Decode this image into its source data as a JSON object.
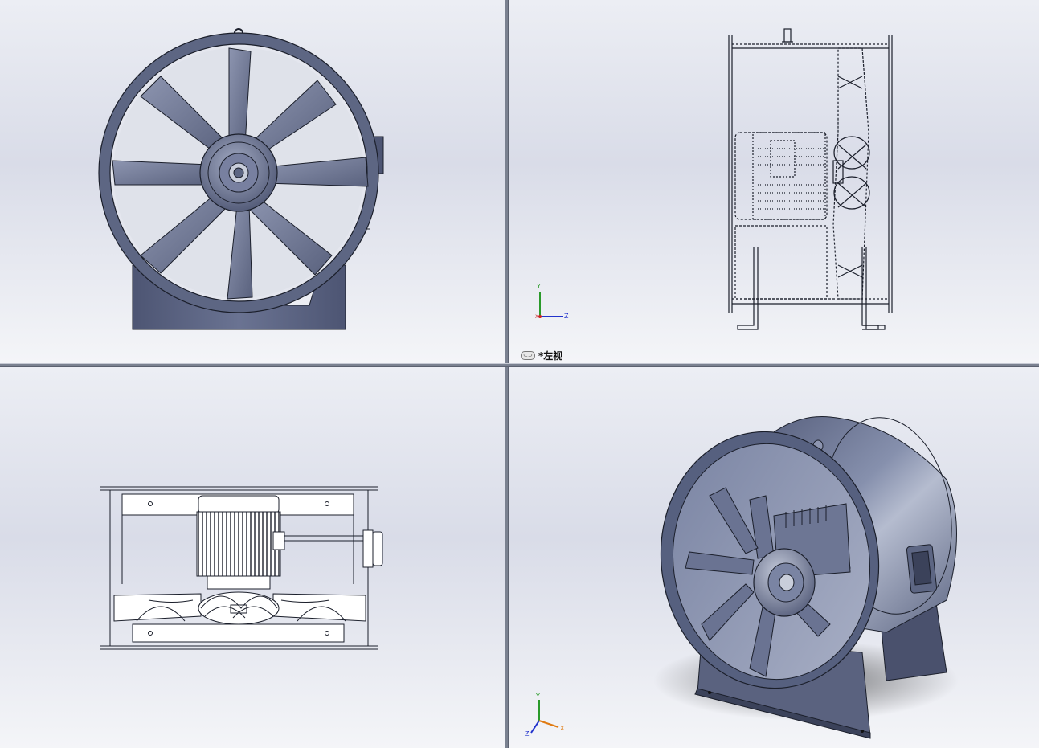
{
  "app": "SolidWorks",
  "viewports": {
    "top_left": {
      "view": "front"
    },
    "top_right": {
      "view_label": "*左视",
      "triad": {
        "y": "Y",
        "z": "Z",
        "x": "X"
      }
    },
    "bottom_left": {
      "view": "top"
    },
    "bottom_right": {
      "view": "isometric",
      "triad": {
        "y": "Y",
        "z": "Z",
        "x": "X"
      }
    }
  },
  "colors": {
    "model": "#5d6683",
    "model_dark": "#3b425a",
    "model_light": "#8a93ad",
    "edge": "#1b1f2b",
    "triad_y": "#2a9a2a",
    "triad_z": "#2233cc",
    "triad_x": "#cc2222",
    "triad_x_iso": "#e07a10"
  },
  "icons": {
    "display_state": "chain-link-icon"
  }
}
